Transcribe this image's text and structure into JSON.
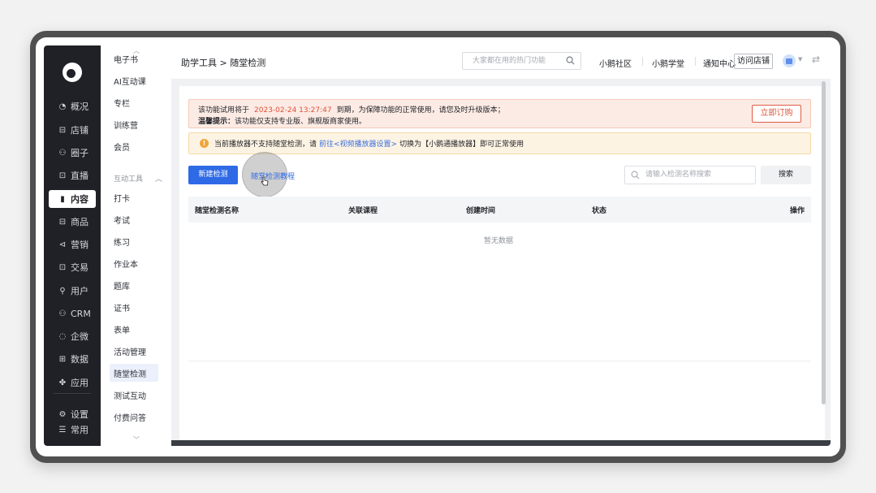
{
  "nav": {
    "items": [
      {
        "label": "概况",
        "icon": "pie-chart-icon",
        "glyph": "◔"
      },
      {
        "label": "店铺",
        "icon": "store-icon",
        "glyph": "⊟"
      },
      {
        "label": "圈子",
        "icon": "community-icon",
        "glyph": "⚇"
      },
      {
        "label": "直播",
        "icon": "live-icon",
        "glyph": "⊡"
      },
      {
        "label": "内容",
        "icon": "content-icon",
        "glyph": "▮",
        "active": true
      },
      {
        "label": "商品",
        "icon": "product-icon",
        "glyph": "⊟"
      },
      {
        "label": "营销",
        "icon": "marketing-icon",
        "glyph": "⊲"
      },
      {
        "label": "交易",
        "icon": "trade-icon",
        "glyph": "⊡"
      },
      {
        "label": "用户",
        "icon": "user-icon",
        "glyph": "⚲"
      },
      {
        "label": "CRM",
        "icon": "crm-icon",
        "glyph": "⚇"
      },
      {
        "label": "企微",
        "icon": "wecom-icon",
        "glyph": "◌"
      },
      {
        "label": "数据",
        "icon": "data-icon",
        "glyph": "⊞"
      },
      {
        "label": "应用",
        "icon": "apps-icon",
        "glyph": "✤"
      }
    ],
    "bottom": [
      {
        "label": "设置",
        "icon": "gear-icon",
        "glyph": "⚙"
      },
      {
        "label": "常用",
        "icon": "list-icon",
        "glyph": "☰"
      }
    ]
  },
  "submenu": {
    "top_items": [
      "电子书",
      "AI互动课",
      "专栏",
      "训练营",
      "会员"
    ],
    "group_label": "互动工具",
    "group_items": [
      "打卡",
      "考试",
      "练习",
      "作业本",
      "题库",
      "证书",
      "表单",
      "活动管理",
      "随堂检测",
      "测试互动",
      "付费问答"
    ],
    "active": "随堂检测"
  },
  "header": {
    "breadcrumb": "助学工具 > 随堂检测",
    "search_placeholder": "大家都在用的热门功能",
    "links": [
      "小鹅社区",
      "小鹅学堂",
      "通知中心"
    ],
    "visit_store": "访问店铺"
  },
  "notice": {
    "line1_prefix": "该功能试用将于",
    "expire_date": "2023-02-24 13:27:47",
    "line1_suffix": "到期，为保障功能的正常使用，请您及时升级版本；",
    "line2_bold": "温馨提示：",
    "line2_text": "该功能仅支持专业版、旗舰版商家使用。",
    "buy_button": "立即订购"
  },
  "player_notice": {
    "prefix": "当前播放器不支持随堂检测，请",
    "link": "前往<视频播放器设置>",
    "suffix": "切换为【小鹅通播放器】即可正常使用"
  },
  "toolbar": {
    "new_button": "新建检测",
    "tutorial_link": "随堂检测教程",
    "search_placeholder": "请输入检测名称搜索",
    "search_button": "搜索"
  },
  "table": {
    "columns": [
      "随堂检测名称",
      "关联课程",
      "创建时间",
      "状态",
      "操作"
    ],
    "empty_text": "暂无数据"
  },
  "colors": {
    "primary": "#2e6ae6",
    "danger": "#e0523a",
    "nav_bg": "#1f2126"
  }
}
